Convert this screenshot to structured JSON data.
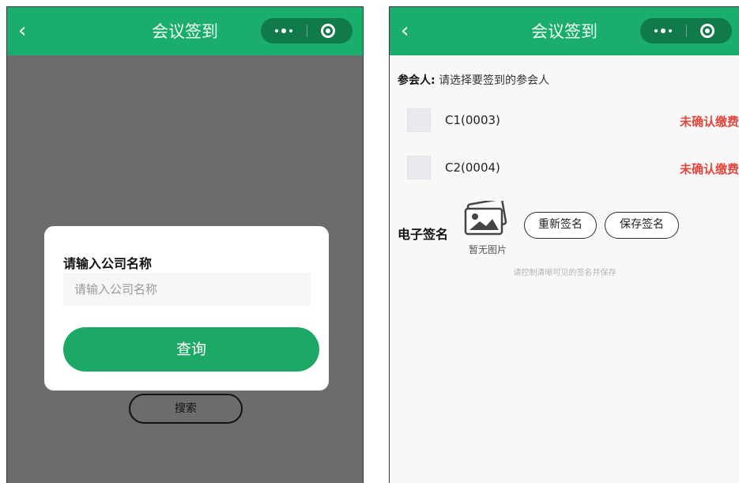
{
  "left_screen": {
    "nav": {
      "back_icon": "chevron-left-icon",
      "title": "会议签到",
      "capsule_more_icon": "more-dots-icon",
      "capsule_close_icon": "close-target-icon"
    },
    "modal": {
      "title": "请输入公司名称",
      "input": {
        "placeholder": "请输入公司名称",
        "value": ""
      },
      "query_button": "查询"
    },
    "search_button": "搜索"
  },
  "right_screen": {
    "nav": {
      "back_icon": "chevron-left-icon",
      "title": "会议签到",
      "capsule_more_icon": "more-dots-icon",
      "capsule_close_icon": "close-target-icon"
    },
    "attendee_label": "参会人:",
    "attendee_prompt": "请选择要签到的参会人",
    "attendees": [
      {
        "name": "C1(0003)",
        "status": "未确认缴费"
      },
      {
        "name": "C2(0004)",
        "status": "未确认缴费"
      }
    ],
    "signature": {
      "label": "电子签名",
      "image_icon": "image-placeholder-icon",
      "no_image_text": "暂无图片",
      "resign_button": "重新签名",
      "save_button": "保存签名",
      "hint": "请控制清晰可见的签名并保存"
    }
  },
  "colors": {
    "nav_green": "#1aad6b",
    "capsule": "#117a4a",
    "button_green": "#1ea866",
    "status_red": "#e2453c"
  }
}
